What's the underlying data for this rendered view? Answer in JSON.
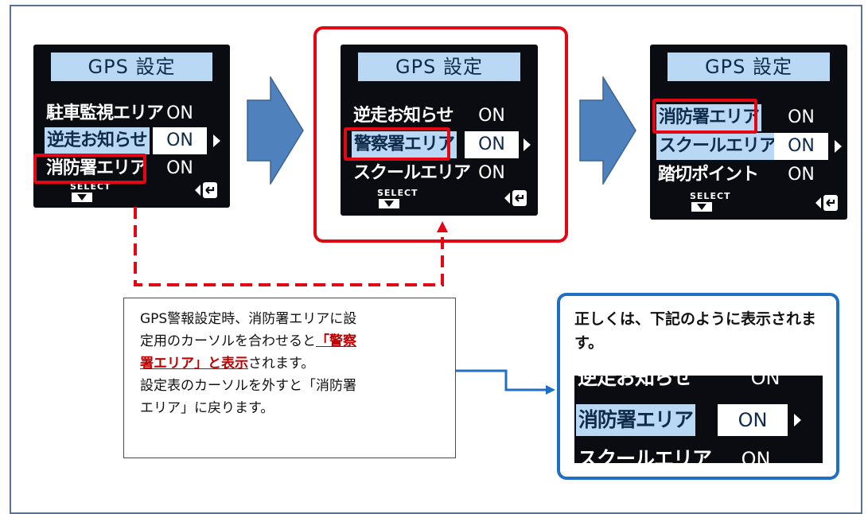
{
  "screens": [
    {
      "title": "GPS 設定",
      "rows": [
        {
          "label": "駐車監視エリア",
          "value": "ON"
        },
        {
          "label": "逆走お知らせ",
          "value": "ON"
        },
        {
          "label": "消防署エリア",
          "value": "ON"
        }
      ],
      "select_label": "SELECT"
    },
    {
      "title": "GPS 設定",
      "rows": [
        {
          "label": "逆走お知らせ",
          "value": "ON"
        },
        {
          "label": "警察署エリア",
          "value": "ON"
        },
        {
          "label": "スクールエリア",
          "value": "ON"
        }
      ],
      "select_label": "SELECT"
    },
    {
      "title": "GPS 設定",
      "rows": [
        {
          "label": "消防署エリア",
          "value": "ON"
        },
        {
          "label": "スクールエリア",
          "value": "ON"
        },
        {
          "label": "踏切ポイント",
          "value": "ON"
        }
      ],
      "select_label": "SELECT"
    }
  ],
  "callout": {
    "line1": "GPS警報設定時、消防署エリアに設",
    "line2_pre": "定用のカーソルを合わせると",
    "line2_em": "「警察",
    "line3_em": "署エリア」と表示",
    "line3_post": "されます。",
    "line4": "設定表のカーソルを外すと「消防署",
    "line5": "エリア」に戻ります。"
  },
  "answer": {
    "title": "正しくは、下記のように表示されます。",
    "rows": [
      {
        "label": "逆走お知らせ",
        "value": "ON"
      },
      {
        "label": "消防署エリア",
        "value": "ON"
      },
      {
        "label": "スクールエリア",
        "value": "ON"
      }
    ]
  },
  "colors": {
    "highlight_red": "#e30613",
    "callout_blue": "#1f6fc5",
    "arrow_blue": "#4f81bd",
    "screen_header": "#b9d8f3"
  }
}
